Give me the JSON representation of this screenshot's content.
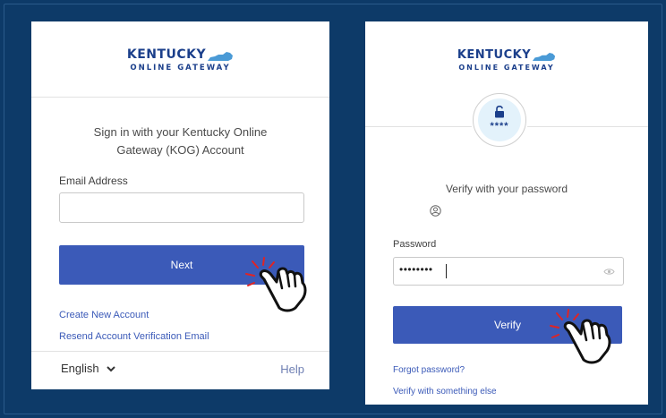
{
  "brand": {
    "name": "KENTUCKY",
    "sub": "ONLINE GATEWAY"
  },
  "signin": {
    "heading_line1": "Sign in with your Kentucky Online",
    "heading_line2": "Gateway (KOG) Account",
    "email_label": "Email Address",
    "email_value": "",
    "next_label": "Next",
    "create_account": "Create New Account",
    "resend_email": "Resend Account Verification Email",
    "language": "English",
    "help": "Help"
  },
  "verify": {
    "lock_mask": "****",
    "heading": "Verify with your password",
    "password_label": "Password",
    "password_value": "••••••••",
    "verify_label": "Verify",
    "forgot": "Forgot password?",
    "other": "Verify with something else"
  },
  "colors": {
    "background": "#0d3a68",
    "button": "#3b5ab8",
    "brand_dark": "#1b3f8b",
    "brand_light": "#4a9ad6"
  }
}
